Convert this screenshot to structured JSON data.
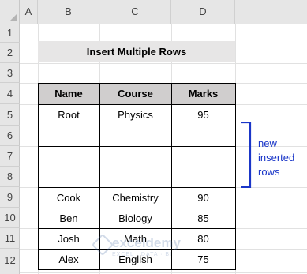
{
  "columns": [
    "A",
    "B",
    "C",
    "D"
  ],
  "rows": [
    "1",
    "2",
    "3",
    "4",
    "5",
    "6",
    "7",
    "8",
    "9",
    "10",
    "11",
    "12"
  ],
  "title": "Insert Multiple Rows",
  "table": {
    "headers": [
      "Name",
      "Course",
      "Marks"
    ],
    "rows": [
      [
        "Root",
        "Physics",
        "95"
      ],
      [
        "",
        "",
        ""
      ],
      [
        "",
        "",
        ""
      ],
      [
        "",
        "",
        ""
      ],
      [
        "Cook",
        "Chemistry",
        "90"
      ],
      [
        "Ben",
        "Biology",
        "85"
      ],
      [
        "Josh",
        "Math",
        "80"
      ],
      [
        "Alex",
        "English",
        "75"
      ]
    ]
  },
  "annotation": {
    "lines": [
      "new",
      "inserted",
      "rows"
    ],
    "color": "#1a36c8"
  },
  "watermark": {
    "name": "exceldemy",
    "tagline": "EXCEL · DATA · BI"
  },
  "colors": {
    "header_fill": "#d0cece",
    "title_fill": "#e7e6e6",
    "sheet_header": "#e6e6e6"
  }
}
